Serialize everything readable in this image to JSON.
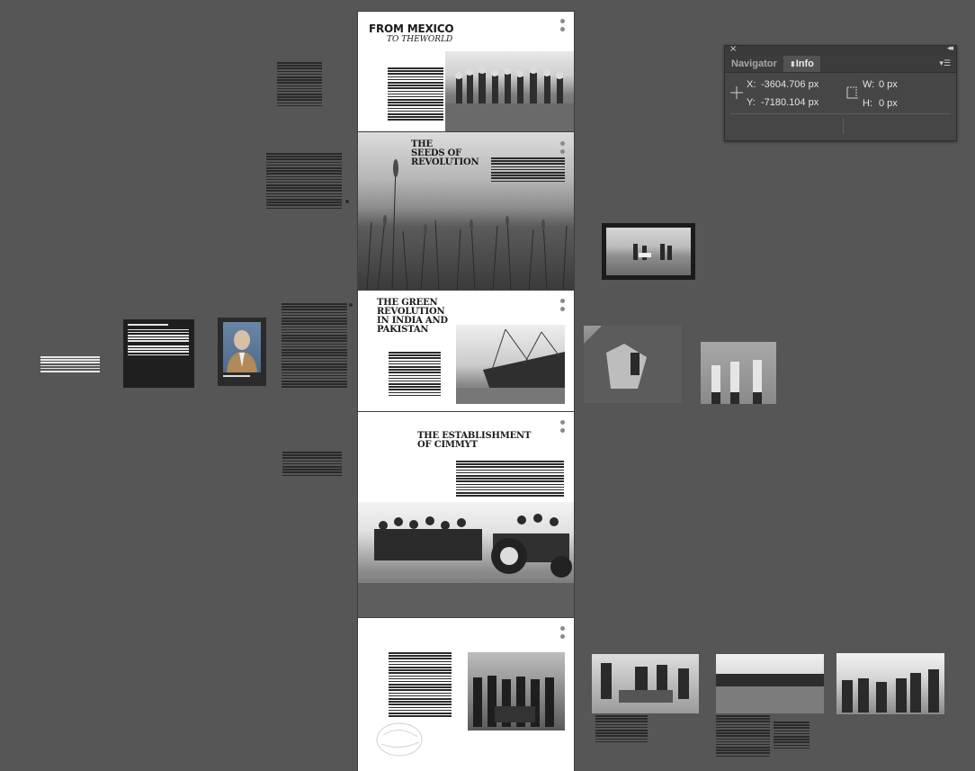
{
  "pages": {
    "p1": {
      "title": "FROM MEXICO",
      "subtitle": "TO THEWORLD"
    },
    "p2": {
      "title_lines": [
        "THE",
        "SEEDS OF",
        "REVOLUTION"
      ]
    },
    "p3": {
      "title_lines": [
        "THE GREEN",
        "REVOLUTION",
        "IN INDIA AND",
        "PAKISTAN"
      ]
    },
    "p4": {
      "title_lines": [
        "THE ESTABLISHMENT",
        "OF CIMMYT"
      ]
    }
  },
  "info_panel": {
    "tabs": [
      "Navigator",
      "Info"
    ],
    "active_tab": "Info",
    "x_label": "X:",
    "x_value": "-3604.706 px",
    "y_label": "Y:",
    "y_value": "-7180.104 px",
    "w_label": "W:",
    "w_value": "0 px",
    "h_label": "H:",
    "h_value": "0 px"
  },
  "colors": {
    "canvas": "#565656",
    "panel": "#464646",
    "page": "#ffffff",
    "ink": "#1a1a1a"
  }
}
